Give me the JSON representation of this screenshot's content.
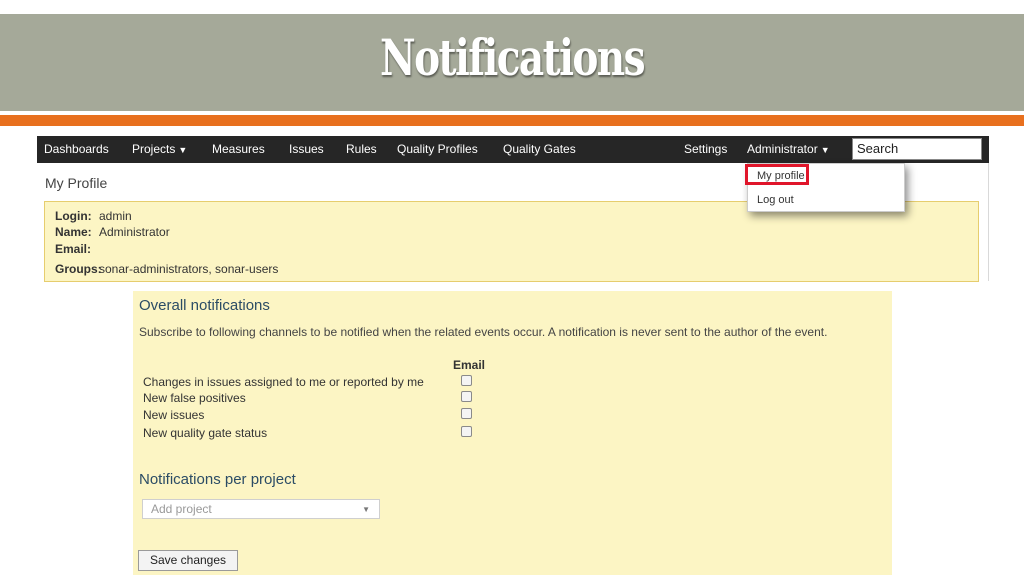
{
  "slide": {
    "title": "Notifications"
  },
  "navbar": {
    "items": [
      "Dashboards",
      "Projects",
      "Measures",
      "Issues",
      "Rules",
      "Quality Profiles",
      "Quality Gates"
    ],
    "settings": "Settings",
    "user_menu": "Administrator",
    "search_value": "Search"
  },
  "user_dropdown": {
    "items": [
      "My profile",
      "Log out"
    ]
  },
  "profile": {
    "title": "My Profile",
    "fields": [
      {
        "label": "Login:",
        "value": "admin"
      },
      {
        "label": "Name:",
        "value": "Administrator"
      },
      {
        "label": "Email:",
        "value": ""
      },
      {
        "label": "Groups:",
        "value": "sonar-administrators, sonar-users"
      }
    ]
  },
  "notifications": {
    "overall_title": "Overall notifications",
    "description": "Subscribe to following channels to be notified when the related events occur. A notification is never sent to the author of the event.",
    "channel_header": "Email",
    "rows": [
      {
        "label": "Changes in issues assigned to me or reported by me",
        "checked": false
      },
      {
        "label": "New false positives",
        "checked": false
      },
      {
        "label": "New issues",
        "checked": false
      },
      {
        "label": "New quality gate status",
        "checked": false
      }
    ],
    "per_project_title": "Notifications per project",
    "add_project_placeholder": "Add project",
    "save_label": "Save changes"
  },
  "colors": {
    "banner": "#a5a999",
    "accent_orange": "#e8701e",
    "navbar": "#262626",
    "panel_yellow": "#fcf5c4",
    "highlight_red": "#e0152a"
  }
}
